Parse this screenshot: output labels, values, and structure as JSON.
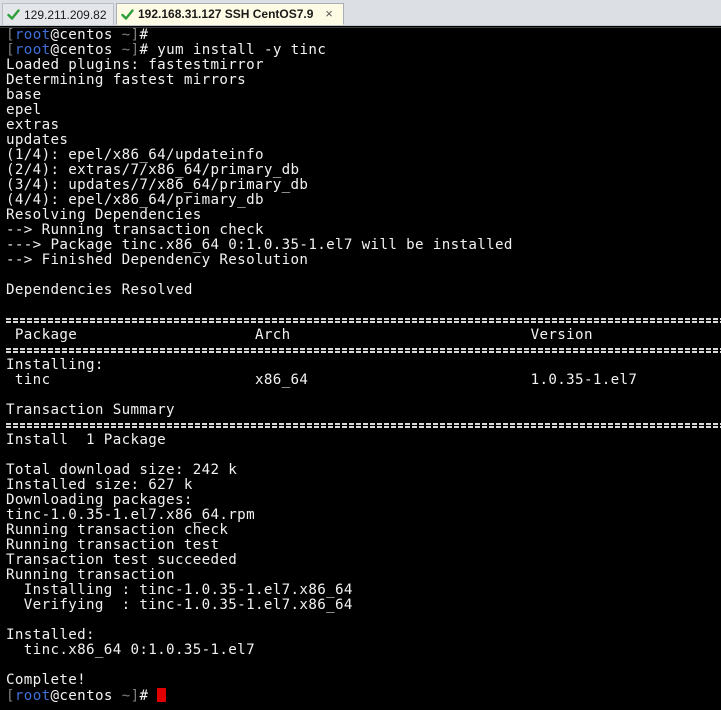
{
  "tabs": [
    {
      "label": "129.211.209.82",
      "active": false,
      "status_icon": "check-icon"
    },
    {
      "label": "192.168.31.127 SSH CentOS7.9",
      "active": true,
      "status_icon": "check-icon",
      "close": "×"
    }
  ],
  "prompt": {
    "user": "root",
    "at": "@",
    "host": "centos",
    "dir": "~",
    "open_bracket": "[",
    "close_bracket": "]",
    "symbol": "#"
  },
  "command": " yum install -y tinc",
  "output": {
    "plugins": "Loaded plugins: fastestmirror",
    "mirrors": "Determining fastest mirrors",
    "repo_base": "base",
    "repo_epel": "epel",
    "repo_extras": "extras",
    "repo_updates": "updates",
    "dl1": "(1/4): epel/x86_64/updateinfo",
    "dl2": "(2/4): extras/7/x86_64/primary_db",
    "dl3": "(3/4): updates/7/x86_64/primary_db",
    "dl4": "(4/4): epel/x86_64/primary_db",
    "resolving": "Resolving Dependencies",
    "check": "--> Running transaction check",
    "package": "---> Package tinc.x86_64 0:1.0.35-1.el7 will be installed",
    "finished": "--> Finished Dependency Resolution",
    "resolved": "Dependencies Resolved",
    "table_header": " Package                    Arch                           Version",
    "installing": "Installing:",
    "table_row": " tinc                       x86_64                         1.0.35-1.el7",
    "summary": "Transaction Summary",
    "install_count": "Install  1 Package",
    "total_size": "Total download size: 242 k",
    "installed_size": "Installed size: 627 k",
    "downloading": "Downloading packages:",
    "rpm": "tinc-1.0.35-1.el7.x86_64.rpm",
    "run_check": "Running transaction check",
    "run_test": "Running transaction test",
    "test_ok": "Transaction test succeeded",
    "running": "Running transaction",
    "installing_step": "  Installing : tinc-1.0.35-1.el7.x86_64",
    "verifying_step": "  Verifying  : tinc-1.0.35-1.el7.x86_64",
    "installed": "Installed:",
    "installed_pkg": "  tinc.x86_64 0:1.0.35-1.el7",
    "complete": "Complete!"
  },
  "colors": {
    "background": "#000000",
    "text": "#f2f2f2",
    "prompt_user": "#3f6fd8",
    "prompt_bracket": "#7f7f7f",
    "cursor": "#e00000",
    "tab_active_bg": "#fdfbe3",
    "check_green": "#2e9e3a"
  }
}
